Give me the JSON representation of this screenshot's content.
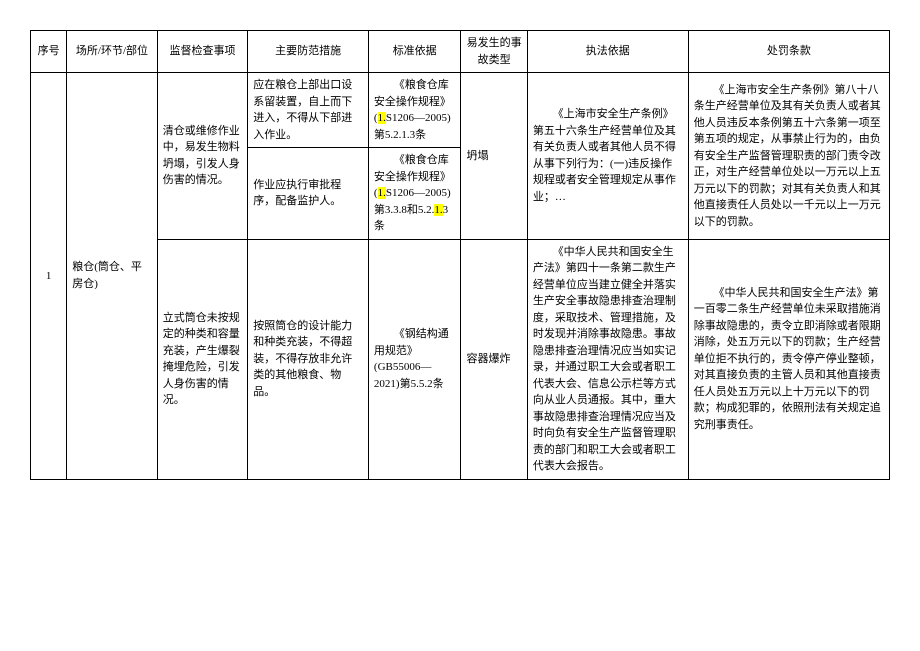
{
  "headers": {
    "seq": "序号",
    "place": "场所/环节/部位",
    "inspection": "监督检查事项",
    "measure": "主要防范措施",
    "basis": "标准依据",
    "accident": "易发生的事故类型",
    "law": "执法依据",
    "penalty": "处罚条款"
  },
  "rows": [
    {
      "seq": "1",
      "place": "粮仓(筒仓、平房仓)",
      "group1": {
        "inspection": "清仓或维修作业中，易发生物料坍塌，引发人身伤害的情况。",
        "law": "《上海市安全生产条例》第五十六条生产经营单位及其有关负责人或者其他人员不得从事下列行为：(一)违反操作规程或者安全管理规定从事作业；…",
        "penalty": "《上海市安全生产条例》第八十八条生产经营单位及其有关负责人或者其他人员违反本条例第五十六条第一项至第五项的规定，从事禁止行为的，由负有安全生产监督管理职责的部门责令改正，对生产经营单位处以一万元以上五万元以下的罚款；对其有关负责人和其他直接责任人员处以一千元以上一万元以下的罚款。",
        "accident": "坍塌",
        "items": [
          {
            "measure": "应在粮仓上部出口设系留装置，自上而下进入，不得从下部进入作业。",
            "basis_title": "《粮食仓库安全操作规程》(",
            "basis_hl": "1.",
            "basis_mid": "S1206—2005)第5.2.1.3条"
          },
          {
            "measure": "作业应执行审批程序，配备监护人。",
            "basis_title": "《粮食仓库安全操作规程》(",
            "basis_hl1": "1.",
            "basis_mid1": "S1206—2005)第3.3.8和5.2.",
            "basis_hl2": "1.",
            "basis_mid2": "3条"
          }
        ]
      },
      "group2": {
        "inspection": "立式筒仓未按规定的种类和容量充装，产生爆裂掩埋危险，引发人身伤害的情况。",
        "measure": "按照筒仓的设计能力和种类充装，不得超装，不得存放非允许类的其他粮食、物品。",
        "basis": "《钢结构通用规范》(GB55006—2021)第5.5.2条",
        "accident": "容器爆炸",
        "law": "《中华人民共和国安全生产法》第四十一条第二款生产经营单位应当建立健全并落实生产安全事故隐患排查治理制度，采取技术、管理措施，及时发现并消除事故隐患。事故隐患排查治理情况应当如实记录，并通过职工大会或者职工代表大会、信息公示栏等方式向从业人员通报。其中，重大事故隐患排查治理情况应当及时向负有安全生产监督管理职责的部门和职工大会或者职工代表大会报告。",
        "penalty": "《中华人民共和国安全生产法》第一百零二条生产经营单位未采取措施消除事故隐患的，责令立即消除或者限期消除，处五万元以下的罚款；生产经营单位拒不执行的，责令停产停业整顿，对其直接负责的主管人员和其他直接责任人员处五万元以上十万元以下的罚款；构成犯罪的，依照刑法有关规定追究刑事责任。"
      }
    }
  ]
}
